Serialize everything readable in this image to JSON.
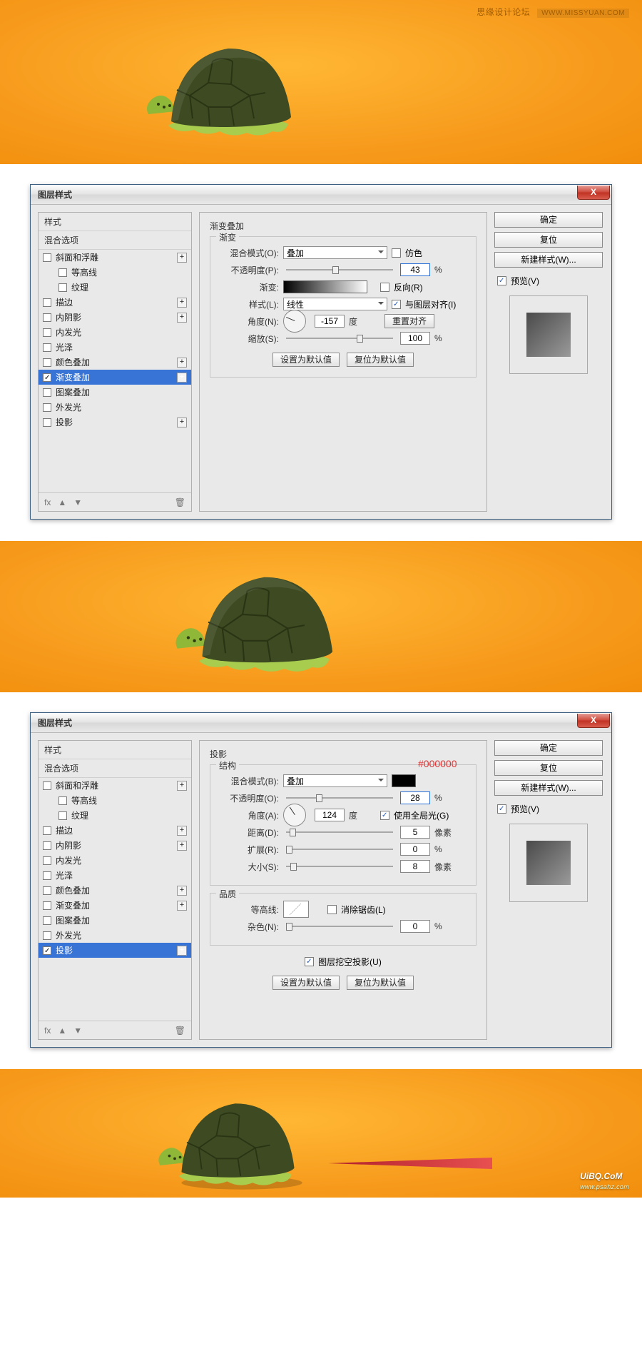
{
  "watermark": {
    "text": "思缘设计论坛",
    "site": "WWW.MISSYUAN.COM"
  },
  "uibq": {
    "main": "UiBQ.CoM",
    "sub": "www.psahz.com"
  },
  "dialog_title": "图层样式",
  "styles_header": "样式",
  "blend_header": "混合选项",
  "effects": {
    "bevel": "斜面和浮雕",
    "contour": "等高线",
    "texture": "纹理",
    "stroke": "描边",
    "inner_shadow": "内阴影",
    "inner_glow": "内发光",
    "satin": "光泽",
    "color_overlay": "颜色叠加",
    "gradient_overlay": "渐变叠加",
    "pattern_overlay": "图案叠加",
    "outer_glow": "外发光",
    "drop_shadow": "投影"
  },
  "fx_label": "fx",
  "buttons": {
    "ok": "确定",
    "reset": "复位",
    "new_style": "新建样式(W)...",
    "preview": "预览(V)"
  },
  "grad": {
    "title": "渐变叠加",
    "group": "渐变",
    "blend_mode_lbl": "混合模式(O):",
    "blend_mode_val": "叠加",
    "dither": "仿色",
    "opacity_lbl": "不透明度(P):",
    "opacity_val": "43",
    "pct": "%",
    "gradient_lbl": "渐变:",
    "reverse": "反向(R)",
    "style_lbl": "样式(L):",
    "style_val": "线性",
    "align": "与图层对齐(I)",
    "angle_lbl": "角度(N):",
    "angle_val": "-157",
    "deg": "度",
    "reset_align": "重置对齐",
    "scale_lbl": "缩放(S):",
    "scale_val": "100",
    "set_default": "设置为默认值",
    "reset_default": "复位为默认值"
  },
  "shadow": {
    "title": "投影",
    "group": "结构",
    "blend_mode_lbl": "混合模式(B):",
    "blend_mode_val": "叠加",
    "color_hex": "#000000",
    "opacity_lbl": "不透明度(O):",
    "opacity_val": "28",
    "angle_lbl": "角度(A):",
    "angle_val": "124",
    "deg": "度",
    "global": "使用全局光(G)",
    "distance_lbl": "距离(D):",
    "distance_val": "5",
    "px": "像素",
    "spread_lbl": "扩展(R):",
    "spread_val": "0",
    "size_lbl": "大小(S):",
    "size_val": "8",
    "quality_group": "品质",
    "contour_lbl": "等高线:",
    "antialias": "消除锯齿(L)",
    "noise_lbl": "杂色(N):",
    "noise_val": "0",
    "knockout": "图层挖空投影(U)",
    "set_default": "设置为默认值",
    "reset_default": "复位为默认值"
  }
}
